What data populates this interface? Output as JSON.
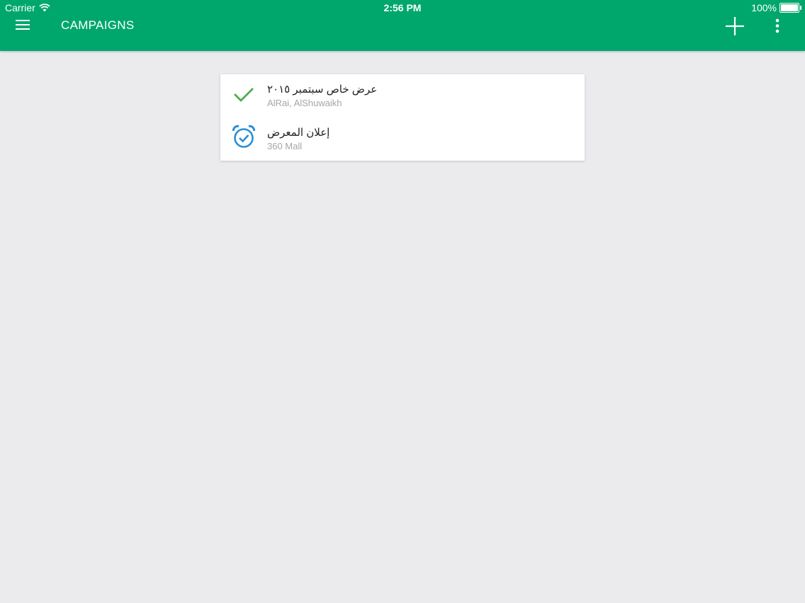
{
  "status_bar": {
    "carrier": "Carrier",
    "time": "2:56 PM",
    "battery": "100%"
  },
  "header": {
    "title": "CAMPAIGNS",
    "menu_icon": "hamburger-menu-icon",
    "add_icon": "plus-icon",
    "more_icon": "more-vertical-icon",
    "bar_color": "#00a76d"
  },
  "campaigns": [
    {
      "title": "عرض خاص سبتمبر ٢٠١٥",
      "subtitle": "AlRai, AlShuwaikh",
      "status_icon": "checkmark-icon",
      "icon_color": "#4caf50"
    },
    {
      "title": "إعلان المعرض",
      "subtitle": "360 Mall",
      "status_icon": "alarm-clock-check-icon",
      "icon_color": "#2b8fd6"
    }
  ]
}
